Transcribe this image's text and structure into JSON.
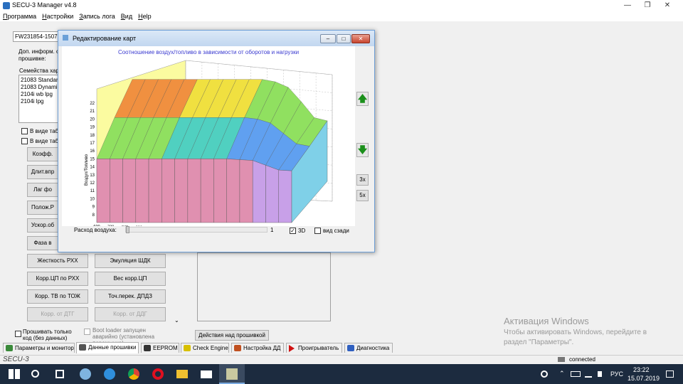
{
  "window": {
    "title": "SECU-3 Manager v4.8"
  },
  "menu": [
    "Программа",
    "Настройки",
    "Запись лога",
    "Вид",
    "Help"
  ],
  "left": {
    "fw_field": "FW231854-15072019",
    "info_label": "Доп. информ. о прошивке:",
    "families_label": "Семейства хар",
    "families": [
      "21083 Standard",
      "21083 Dynamic",
      "2104i wb lpg",
      "2104i lpg"
    ],
    "cb_table1": "В виде табл",
    "cb_table2": "В виде табл",
    "buttons": [
      "Коэфф.",
      "Длит.впр",
      "Лаг фо",
      "Полож.Р",
      "Ускор.об",
      "Фаза в",
      "Жесткость РХХ",
      "Эмуляция ШДК",
      "Корр.ЦП по РХХ",
      "Вес корр.ЦП",
      "Корр. ТВ по ТОЖ",
      "Точ.перек. ДПДЗ",
      "Корр. от ДТГ",
      "Корр. от ДДГ"
    ],
    "flash_code_only": "Прошивать только код (без данных)",
    "bootloader": "Boot loader запущен аварийно (установлена перемычка)",
    "fw_actions": "Действия над прошивкой"
  },
  "tabs": [
    {
      "label": "Параметры и монитор",
      "color": "#3a8a3a"
    },
    {
      "label": "Данные прошивки",
      "color": "#555555"
    },
    {
      "label": "EEPROM",
      "color": "#333333"
    },
    {
      "label": "Check Engine",
      "color": "#d8c000"
    },
    {
      "label": "Настройка ДД",
      "color": "#c05020"
    },
    {
      "label": "Проигрыватель",
      "color": "#d01010"
    },
    {
      "label": "Диагностика",
      "color": "#3060c0"
    }
  ],
  "status": {
    "app": "SECU-3",
    "conn": "connected"
  },
  "watermark": {
    "title": "Активация Windows",
    "line1": "Чтобы активировать Windows, перейдите в",
    "line2": "раздел \"Параметры\"."
  },
  "taskbar": {
    "lang": "РУС",
    "time": "23:22",
    "date": "15.07.2019"
  },
  "dialog": {
    "title": "Редактирование карт",
    "chart_title": "Соотношение воздух/топливо в зависимости от оборотов и нагрузки",
    "y_label": "Воздух/Топливо",
    "x_label": "Обороты (мин-1)",
    "y_ticks": [
      "22",
      "21",
      "20",
      "19",
      "18",
      "17",
      "16",
      "15",
      "14",
      "13",
      "12",
      "11",
      "10",
      "9",
      "8"
    ],
    "x_ticks": [
      "600",
      "720",
      "840",
      "990",
      "1170",
      "1380",
      "1650",
      "1950",
      "2310",
      "2730",
      "3210",
      "3840",
      "4530",
      "5370",
      "6360",
      "7500"
    ],
    "up_icon": "up-arrow-icon",
    "down_icon": "down-arrow-icon",
    "btn_3x": "3x",
    "btn_5x": "5x",
    "air_label": "Расход воздуха:",
    "air_value": "1",
    "cb3d": "3D",
    "back_view": "вид сзади",
    "accent": "#3a3ad0"
  },
  "chart_data": {
    "type": "surface",
    "title": "Соотношение воздух/топливо в зависимости от оборотов и нагрузки",
    "xlabel": "Обороты (мин-1)",
    "ylabel": "Воздух/Топливо",
    "x": [
      600,
      720,
      840,
      990,
      1170,
      1380,
      1650,
      1950,
      2310,
      2730,
      3210,
      3840,
      4530,
      5370,
      6360,
      7500
    ],
    "ylim": [
      7,
      22
    ],
    "series": [
      {
        "values": [
          15.0,
          15.0,
          15.0,
          15.0,
          15.0,
          15.0,
          15.0,
          15.0,
          15.0,
          15.0,
          15.0,
          14.9,
          14.8,
          14.2,
          13.6,
          13.5
        ]
      },
      {
        "values": [
          17.6,
          17.6,
          17.6,
          17.6,
          17.6,
          17.6,
          17.6,
          17.6,
          17.6,
          17.6,
          17.6,
          17.4,
          16.9,
          15.6,
          14.3,
          14.0
        ]
      },
      {
        "values": [
          19.8,
          19.8,
          19.8,
          19.8,
          19.8,
          19.8,
          19.8,
          19.8,
          19.8,
          19.8,
          19.8,
          19.5,
          18.8,
          17.0,
          15.0,
          14.6
        ]
      }
    ]
  }
}
